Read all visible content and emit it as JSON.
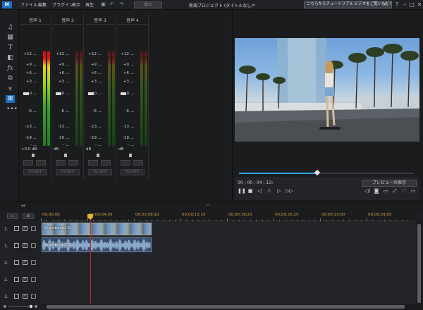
{
  "app": {
    "logo": "Di",
    "menu": [
      "ファイル",
      "編集",
      "プラグイン",
      "表示",
      "再生"
    ],
    "output_button": "出力",
    "project_title": "新規プロジェクト (タイトルなし)*",
    "tutorial_button": "こちらからチュートリアル ビデオをご覧いただけます。",
    "window_buttons": [
      "?",
      "–",
      "□",
      "✕"
    ]
  },
  "toolbar_icons": [
    "folder-music-icon",
    "media-library-icon",
    "title-icon",
    "transition-icon",
    "fx-icon",
    "pip-icon",
    "particle-icon",
    "audio-mixer-icon",
    "more-icon"
  ],
  "mixer": {
    "channels": [
      {
        "name": "音声 1",
        "active": true,
        "volume": "+0.0",
        "unit": "dB",
        "reset_label": "元に戻す"
      },
      {
        "name": "音声 2",
        "active": false,
        "volume": "",
        "unit": "dB",
        "reset_label": "元に戻す"
      },
      {
        "name": "音声 3",
        "active": false,
        "volume": "",
        "unit": "dB",
        "reset_label": "元に戻す"
      },
      {
        "name": "音声 4",
        "active": false,
        "volume": "",
        "unit": "dB",
        "reset_label": "元に戻す"
      }
    ],
    "scale": [
      "+12",
      "+9",
      "+6",
      "+3",
      "0",
      "-6",
      "-13",
      "-19",
      "-"
    ]
  },
  "preview": {
    "timecode": "00 ; 00 ; 04 ; 13",
    "timecode_dropdown": "",
    "scrub_progress": 0.45,
    "preview_display_button": "プレビューの表示"
  },
  "timeline": {
    "ruler": [
      "00;00;00",
      "00;00;04;05",
      "00;00;08;10",
      "00;00;12;15",
      "00;00;16;20",
      "00;00;20;25",
      "00;00;25;00",
      "00;00;29;05"
    ],
    "tracks": [
      {
        "label": "1.",
        "type": "video"
      },
      {
        "label": "1.",
        "type": "audio"
      },
      {
        "label": "2.",
        "type": "video"
      },
      {
        "label": "2.",
        "type": "audio"
      },
      {
        "label": "3.",
        "type": "video"
      }
    ],
    "clips": {
      "video_label": "Skateboard-01",
      "audio_label": "Skateboard-01"
    },
    "header_buttons": [
      "▭",
      "⊞"
    ]
  },
  "colors": {
    "accent_blue": "#2ea7ea",
    "playhead": "#c0282b",
    "ruler_text": "#cda23f",
    "meter_red": "#dd1111",
    "meter_green": "#37a52a"
  }
}
